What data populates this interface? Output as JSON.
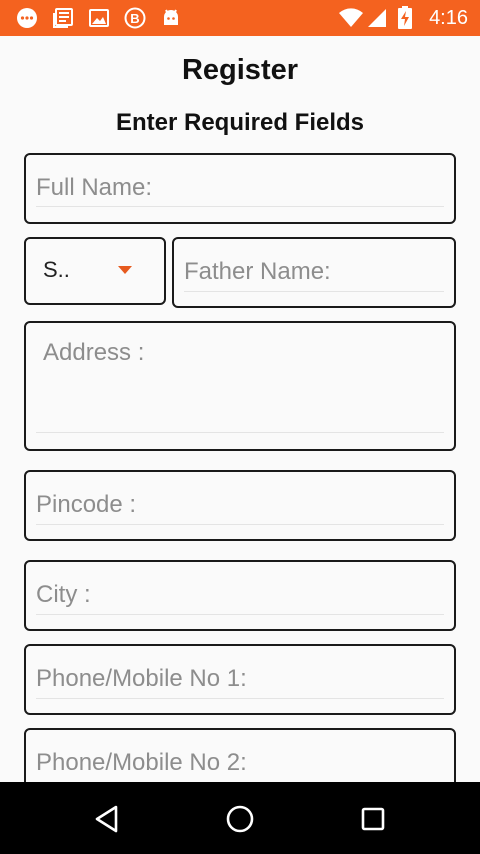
{
  "status_bar": {
    "time": "4:16",
    "left_icons": [
      "chat-bubble-icon",
      "news-icon",
      "image-icon",
      "b-badge-icon",
      "android-icon"
    ],
    "right_icons": [
      "wifi-icon",
      "signal-icon",
      "battery-charging-icon"
    ],
    "color": "#f4621f"
  },
  "page": {
    "title": "Register",
    "subtitle": "Enter Required Fields"
  },
  "form": {
    "full_name": {
      "placeholder": "Full Name:",
      "value": ""
    },
    "salutation": {
      "selected": "S..",
      "options_visible": [
        "S.."
      ]
    },
    "father_name": {
      "placeholder": "Father Name:",
      "value": ""
    },
    "address": {
      "placeholder": "Address :",
      "value": ""
    },
    "pincode": {
      "placeholder": "Pincode :",
      "value": ""
    },
    "city": {
      "placeholder": "City :",
      "value": ""
    },
    "phone1": {
      "placeholder": "Phone/Mobile No 1:",
      "value": ""
    },
    "phone2": {
      "placeholder": "Phone/Mobile No 2:",
      "value": ""
    }
  },
  "nav_bar": {
    "buttons": [
      "back-icon",
      "home-icon",
      "recents-icon"
    ]
  }
}
